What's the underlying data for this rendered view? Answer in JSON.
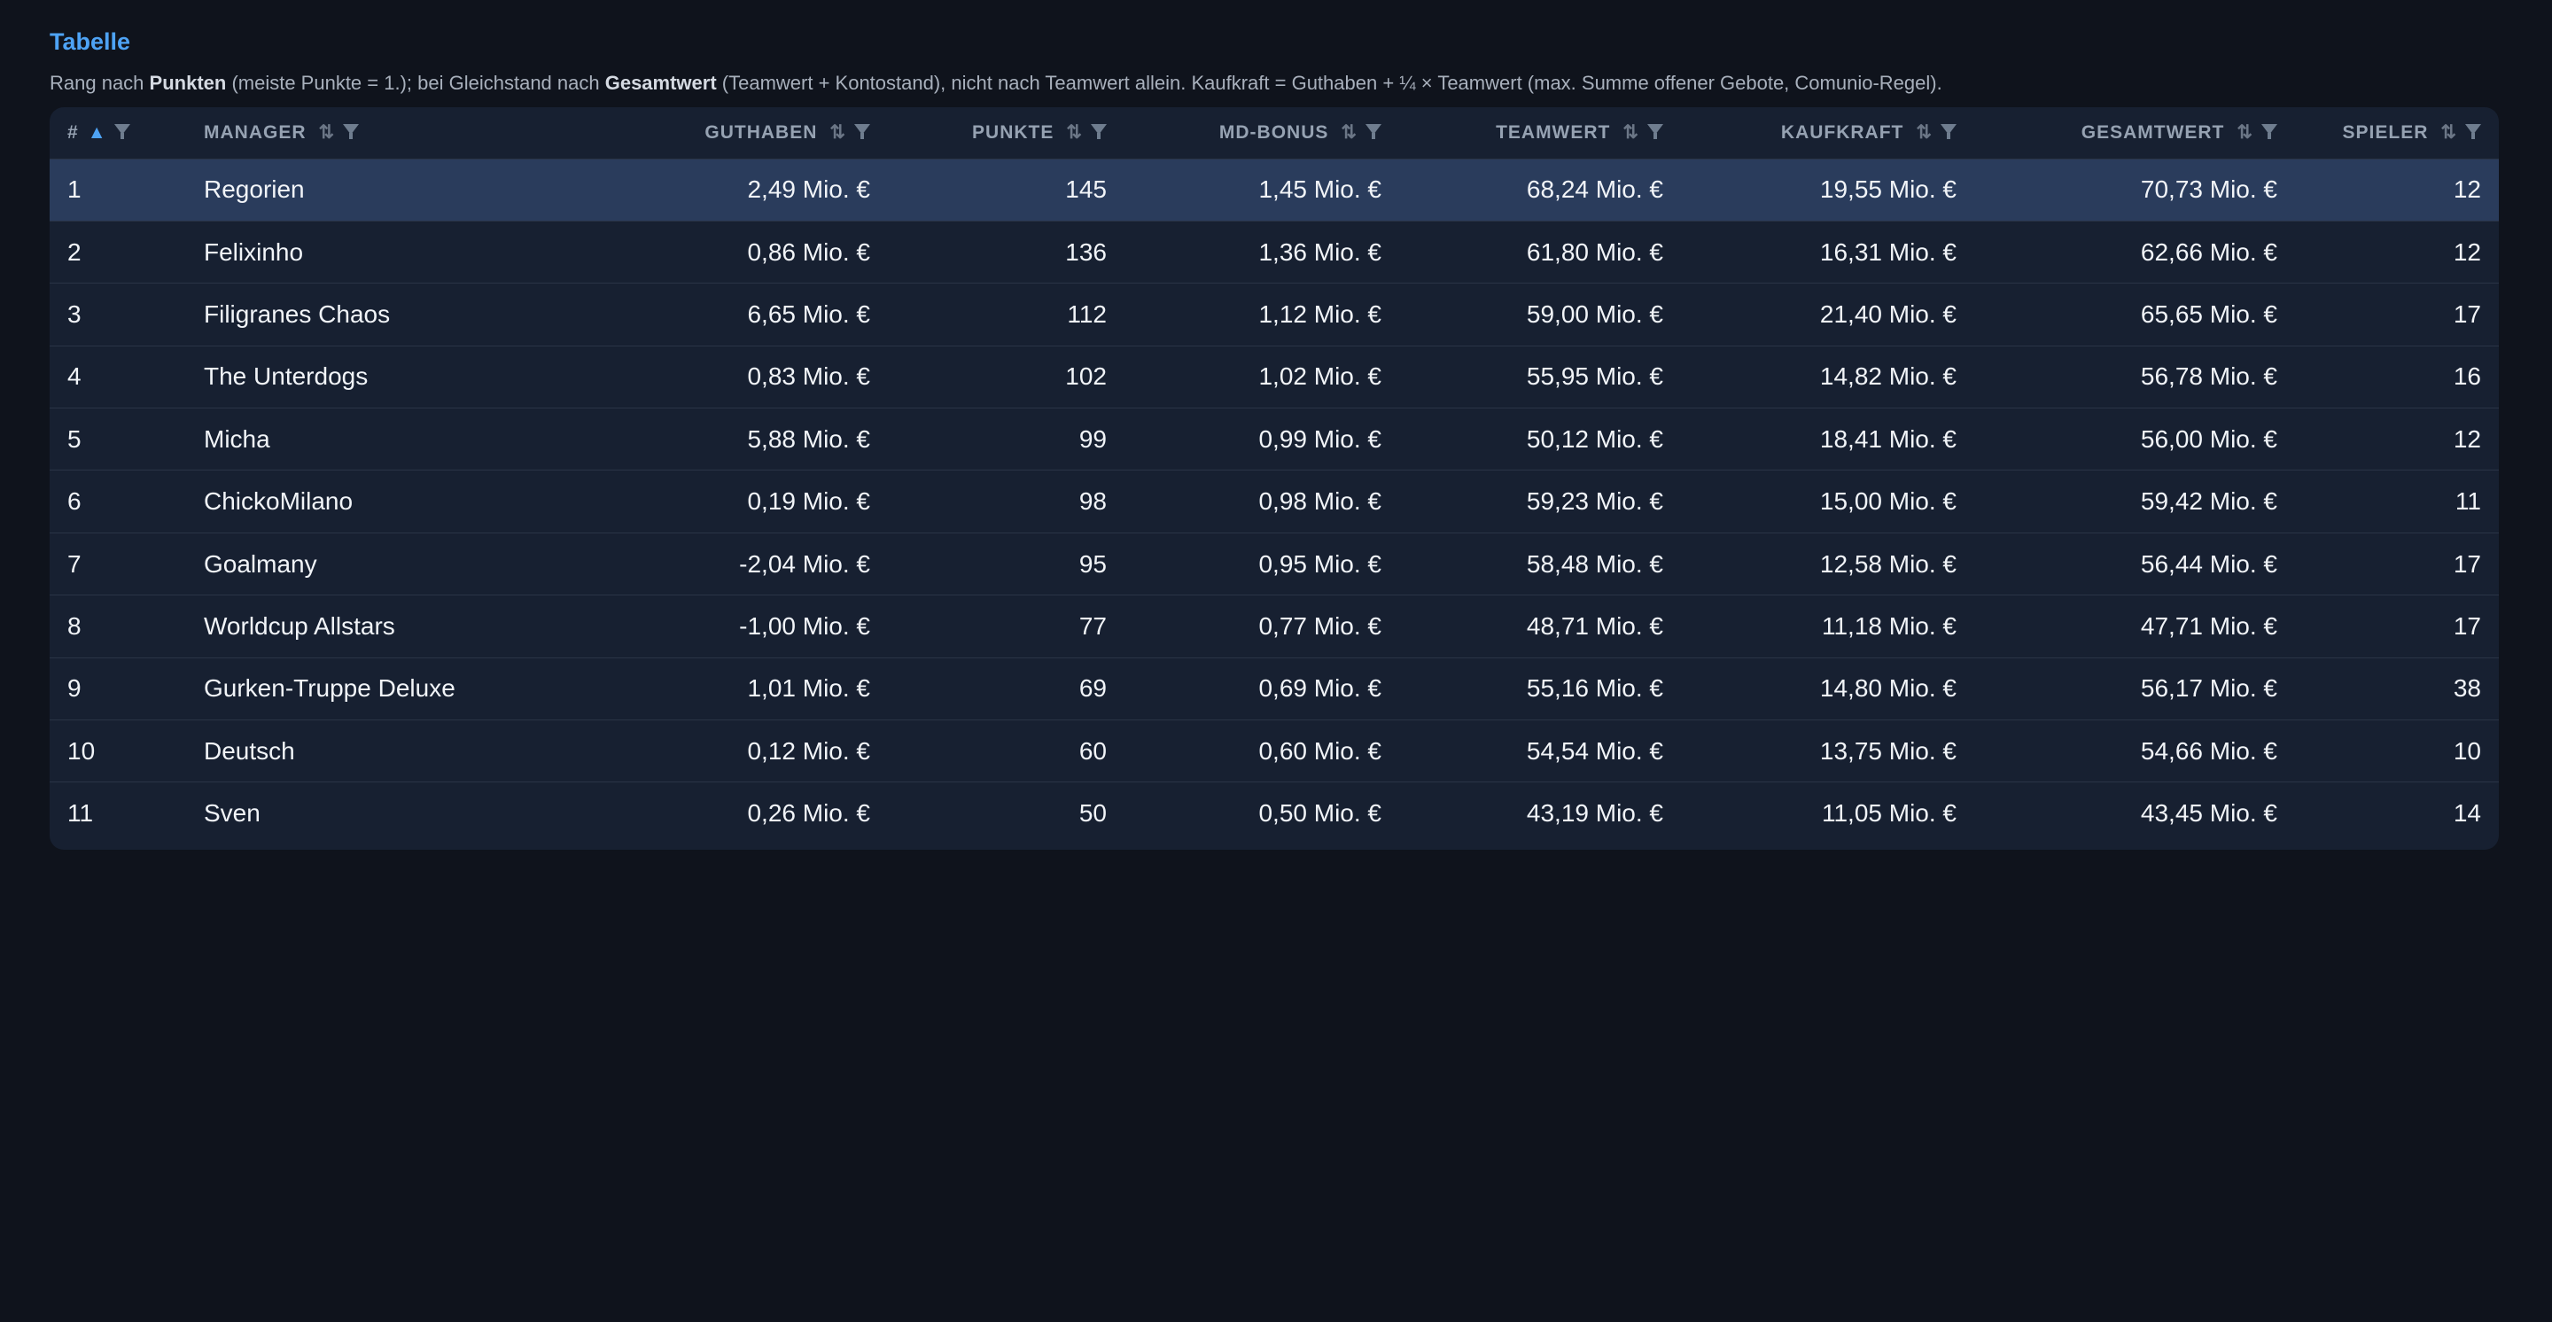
{
  "title": "Tabelle",
  "description": {
    "p1": "Rang nach ",
    "b1": "Punkten",
    "p2": " (meiste Punkte = 1.); bei Gleichstand nach ",
    "b2": "Gesamtwert",
    "p3": " (Teamwert + Kontostand), nicht nach Teamwert allein. Kaufkraft = Guthaben + ¼ × Teamwert (max. Summe offener Gebote, Comunio-Regel)."
  },
  "columns": [
    {
      "label": "#",
      "sort": "▲",
      "active": true
    },
    {
      "label": "Manager",
      "sort": "⇅",
      "active": false
    },
    {
      "label": "Guthaben",
      "sort": "⇅",
      "active": false
    },
    {
      "label": "Punkte",
      "sort": "⇅",
      "active": false
    },
    {
      "label": "MD-Bonus",
      "sort": "⇅",
      "active": false
    },
    {
      "label": "Teamwert",
      "sort": "⇅",
      "active": false
    },
    {
      "label": "Kaufkraft",
      "sort": "⇅",
      "active": false
    },
    {
      "label": "Gesamtwert",
      "sort": "⇅",
      "active": false
    },
    {
      "label": "Spieler",
      "sort": "⇅",
      "active": false
    }
  ],
  "rows": [
    [
      "1",
      "Regorien",
      "2,49 Mio. €",
      "145",
      "1,45 Mio. €",
      "68,24 Mio. €",
      "19,55 Mio. €",
      "70,73 Mio. €",
      "12"
    ],
    [
      "2",
      "Felixinho",
      "0,86 Mio. €",
      "136",
      "1,36 Mio. €",
      "61,80 Mio. €",
      "16,31 Mio. €",
      "62,66 Mio. €",
      "12"
    ],
    [
      "3",
      "Filigranes Chaos",
      "6,65 Mio. €",
      "112",
      "1,12 Mio. €",
      "59,00 Mio. €",
      "21,40 Mio. €",
      "65,65 Mio. €",
      "17"
    ],
    [
      "4",
      "The Unterdogs",
      "0,83 Mio. €",
      "102",
      "1,02 Mio. €",
      "55,95 Mio. €",
      "14,82 Mio. €",
      "56,78 Mio. €",
      "16"
    ],
    [
      "5",
      "Micha",
      "5,88 Mio. €",
      "99",
      "0,99 Mio. €",
      "50,12 Mio. €",
      "18,41 Mio. €",
      "56,00 Mio. €",
      "12"
    ],
    [
      "6",
      "ChickoMilano",
      "0,19 Mio. €",
      "98",
      "0,98 Mio. €",
      "59,23 Mio. €",
      "15,00 Mio. €",
      "59,42 Mio. €",
      "11"
    ],
    [
      "7",
      "Goalmany",
      "-2,04 Mio. €",
      "95",
      "0,95 Mio. €",
      "58,48 Mio. €",
      "12,58 Mio. €",
      "56,44 Mio. €",
      "17"
    ],
    [
      "8",
      "Worldcup Allstars",
      "-1,00 Mio. €",
      "77",
      "0,77 Mio. €",
      "48,71 Mio. €",
      "11,18 Mio. €",
      "47,71 Mio. €",
      "17"
    ],
    [
      "9",
      "Gurken-Truppe Deluxe",
      "1,01 Mio. €",
      "69",
      "0,69 Mio. €",
      "55,16 Mio. €",
      "14,80 Mio. €",
      "56,17 Mio. €",
      "38"
    ],
    [
      "10",
      "Deutsch",
      "0,12 Mio. €",
      "60",
      "0,60 Mio. €",
      "54,54 Mio. €",
      "13,75 Mio. €",
      "54,66 Mio. €",
      "10"
    ],
    [
      "11",
      "Sven",
      "0,26 Mio. €",
      "50",
      "0,50 Mio. €",
      "43,19 Mio. €",
      "11,05 Mio. €",
      "43,45 Mio. €",
      "14"
    ]
  ],
  "highlight_row": 0,
  "colors": {
    "background": "#0f131c",
    "card": "#172031",
    "highlight": "#2a3c5c",
    "accent": "#4ea3f5"
  }
}
